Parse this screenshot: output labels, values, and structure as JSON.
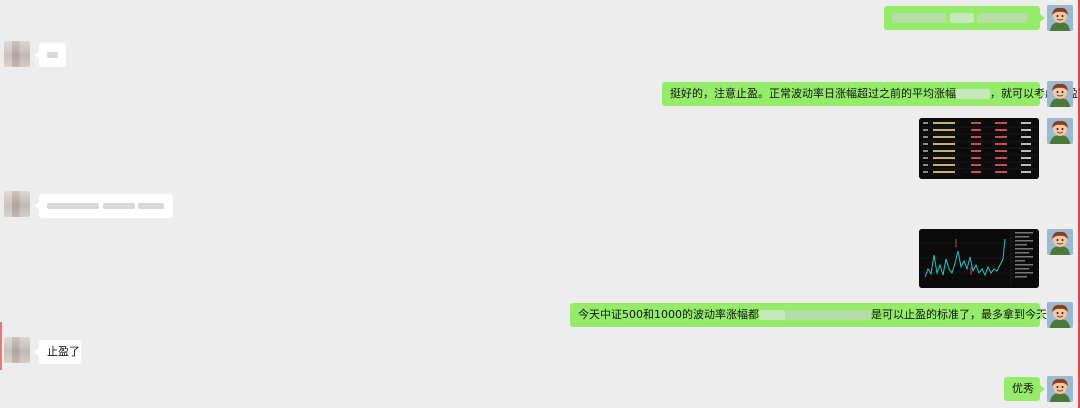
{
  "messages": {
    "m3": {
      "prefix": "挺好的，注意止盈。正常波动率日涨幅超过之前的平均涨幅",
      "suffix": "，就可以考虑止盈了"
    },
    "m6": {
      "prefix": "今天中证500和1000的波动率涨幅都",
      "suffix": "是可以止盈的标准了，最多拿到今天尾盘。"
    },
    "m7": {
      "text": "止盈了"
    },
    "m8": {
      "text": "优秀"
    }
  },
  "colors": {
    "background": "#ededed",
    "bubble_self": "#95ec69",
    "bubble_friend": "#ffffff",
    "chart_line": "#22c6c6"
  },
  "icons": {
    "self_avatar": "cartoon-character-icon",
    "friend_avatar": "blurred-photo-icon"
  }
}
